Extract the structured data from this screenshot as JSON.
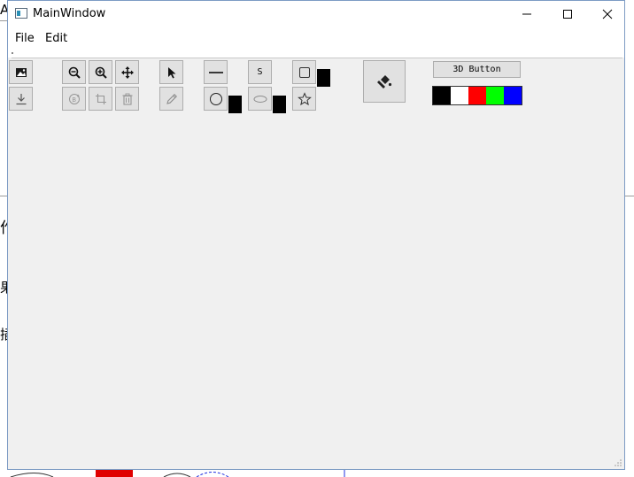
{
  "window": {
    "title": "MainWindow",
    "controls": {
      "minimize": "minimize-icon",
      "maximize": "maximize-icon",
      "close": "close-icon"
    }
  },
  "menu": {
    "items": [
      "File",
      "Edit"
    ]
  },
  "background_glyphs": [
    "A",
    "作",
    "果",
    "插"
  ],
  "toolbar": {
    "image_tools": [
      "image-icon",
      "download-icon"
    ],
    "view_tools": [
      "zoom-out-icon",
      "zoom-in-icon",
      "move-icon",
      "rotate-icon",
      "crop-icon",
      "trash-icon"
    ],
    "draw_tools": [
      "pointer-icon",
      "pencil-icon"
    ],
    "shape_tools": [
      "line-icon",
      "circle-icon",
      "ellipse-icon",
      "rectangle-icon",
      "star-icon"
    ],
    "s_button": "S",
    "fill_button": "paint-bucket-icon",
    "button_3d": "3D Button",
    "palette_colors": [
      "#000000",
      "#ffffff",
      "#ff0000",
      "#00ff00",
      "#0000ff"
    ]
  }
}
